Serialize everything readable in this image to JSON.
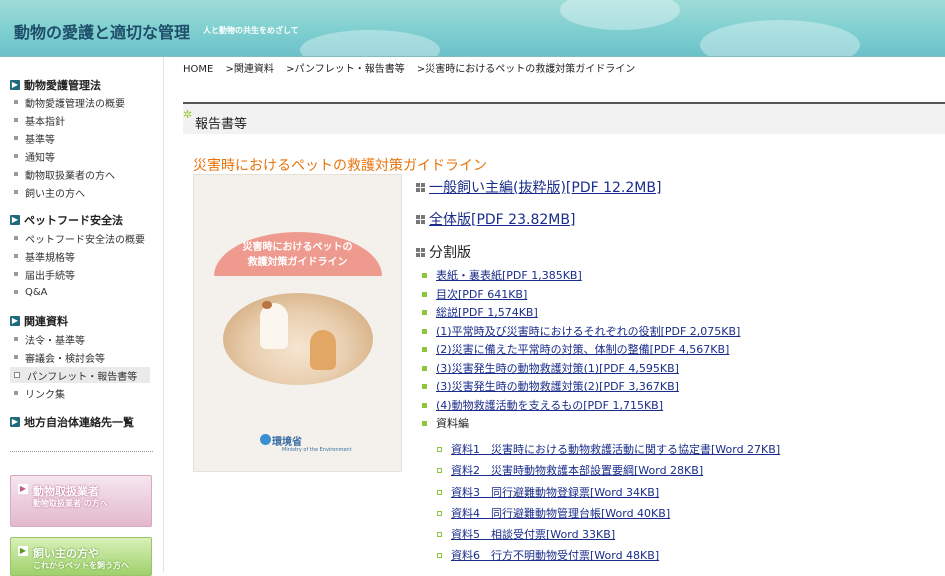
{
  "header": {
    "title": "動物の愛護と適切な管理",
    "subtitle": "人と動物の共生をめざして"
  },
  "sidebar": {
    "sections": [
      {
        "heading": "動物愛護管理法",
        "items": [
          "動物愛護管理法の概要",
          "基本指針",
          "基準等",
          "通知等",
          "動物取扱業者の方へ",
          "飼い主の方へ"
        ]
      },
      {
        "heading": "ペットフード安全法",
        "items": [
          "ペットフード安全法の概要",
          "基準規格等",
          "届出手続等",
          "Q&A"
        ]
      },
      {
        "heading": "関連資料",
        "items": [
          "法令・基準等",
          "審議会・検討会等",
          "パンフレット・報告書等",
          "リンク集"
        ],
        "active_index": 2
      },
      {
        "heading": "地方自治体連絡先一覧",
        "items": []
      }
    ],
    "banners": [
      {
        "label": "動物取扱業者",
        "sub": "動物取扱業者 の方へ"
      },
      {
        "label": "飼い主の方や",
        "sub": "これからペットを飼う方へ"
      }
    ]
  },
  "breadcrumb": [
    "HOME",
    ">関連資料",
    ">パンフレット・報告書等",
    ">災害時におけるペットの救護対策ガイドライン"
  ],
  "section_title": "報告書等",
  "doc_title": "災害時におけるペットの救護対策ガイドライン",
  "cover": {
    "title_line1": "災害時におけるペットの",
    "title_line2": "救護対策ガイドライン",
    "logo": "環境省",
    "logo_sub": "Ministry of the Environment"
  },
  "main_links": [
    {
      "label": "一般飼い主編(抜粋版)[PDF 12.2MB]",
      "link": true
    },
    {
      "label": "全体版[PDF 23.82MB]",
      "link": true
    },
    {
      "label": "分割版",
      "link": false
    }
  ],
  "parts": [
    "表紙・裏表紙[PDF 1,385KB]",
    "目次[PDF 641KB]",
    "総説[PDF 1,574KB]",
    "(1)平常時及び災害時におけるそれぞれの役割[PDF 2,075KB]",
    "(2)災害に備えた平常時の対策、体制の整備[PDF 4,567KB]",
    "(3)災害発生時の動物救護対策(1)[PDF 4,595KB]",
    "(3)災害発生時の動物救護対策(2)[PDF 3,367KB]",
    "(4)動物救護活動を支えるもの[PDF 1,715KB]"
  ],
  "shiryo_heading": "資料編",
  "shiryo": [
    "資料1　災害時における動物救護活動に関する協定書[Word 27KB]",
    "資料2　災害時動物救護本部設置要綱[Word 28KB]",
    "資料3　同行避難動物登録票[Word 34KB]",
    "資料4　同行避難動物管理台帳[Word 40KB]",
    "資料5　相談受付票[Word 33KB]",
    "資料6　行方不明動物受付票[Word 48KB]"
  ]
}
